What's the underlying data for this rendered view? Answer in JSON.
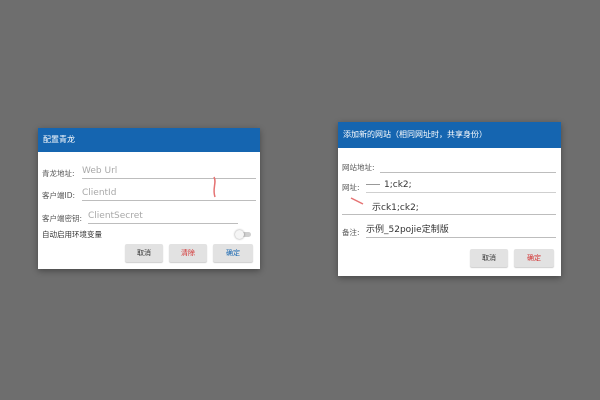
{
  "left_dialog": {
    "title": "配置青龙",
    "fields": [
      {
        "label": "青龙地址:",
        "placeholder": "Web Url"
      },
      {
        "label": "客户端ID:",
        "placeholder": "ClientId"
      },
      {
        "label": "客户端密钥:",
        "placeholder": "ClientSecret"
      }
    ],
    "toggle_label": "自动启用环境变量",
    "toggle_on": false,
    "buttons": {
      "cancel": "取消",
      "clear": "清除",
      "confirm": "确定"
    }
  },
  "right_dialog": {
    "title": "添加新的网站（相同网址时，共享身份）",
    "fields": {
      "site_label": "网站地址:",
      "url_label": "网址:",
      "url_value": "1;ck2;",
      "url_line2": "示ck1;ck2;",
      "note_label": "备注:",
      "note_value": "示例_52pojie定制版"
    },
    "buttons": {
      "cancel": "取消",
      "confirm": "确定"
    }
  },
  "colors": {
    "background": "#6e6e6e",
    "title_bar": "#1565b0",
    "clear_text": "#d32f2f",
    "confirm_text_left": "#1565b0",
    "confirm_text_right": "#d32f2f"
  }
}
